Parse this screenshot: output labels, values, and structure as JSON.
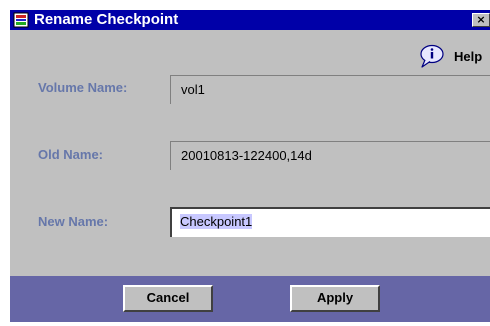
{
  "window": {
    "title": "Rename Checkpoint",
    "close_glyph": "×",
    "title_bar_color": "#0000a8",
    "icon": "app-icon"
  },
  "toolbar": {
    "help_label": "Help",
    "help_icon": "info-balloon-icon"
  },
  "form": {
    "volume_name_label": "Volume Name:",
    "volume_name_value": "vol1",
    "old_name_label": "Old Name:",
    "old_name_value": "20010813-122400,14d",
    "new_name_label": "New Name:",
    "new_name_value": "Checkpoint1",
    "label_color": "#6677aa"
  },
  "footer": {
    "cancel_label": "Cancel",
    "apply_label": "Apply",
    "bar_color": "#6666a6"
  }
}
